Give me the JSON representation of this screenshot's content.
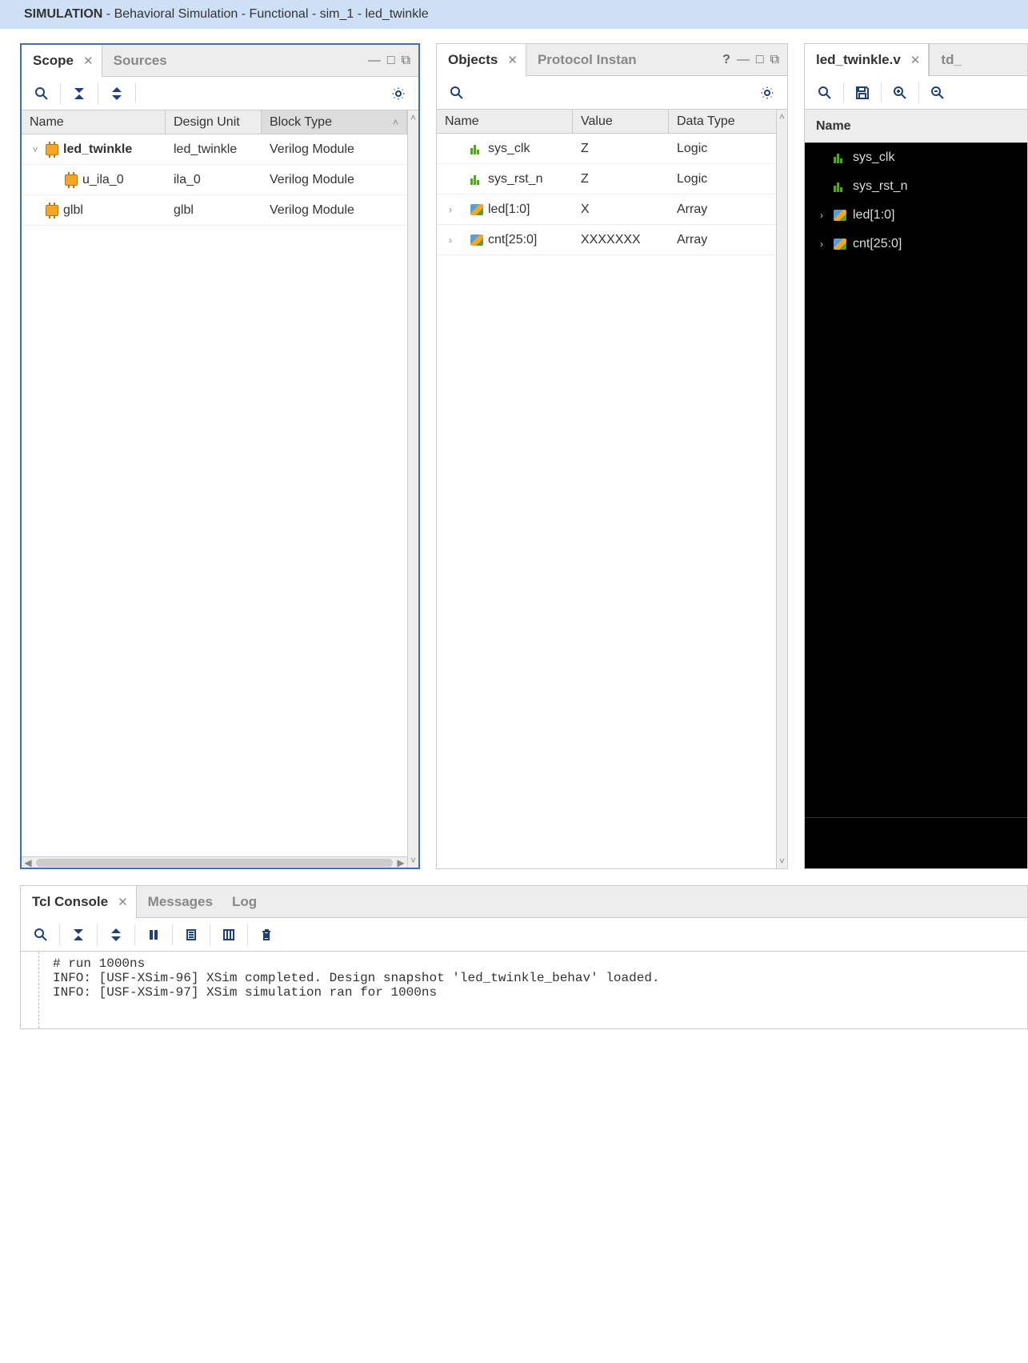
{
  "title": {
    "bold": "SIMULATION",
    "rest": " - Behavioral Simulation - Functional - sim_1 - led_twinkle"
  },
  "scope": {
    "tab_active": "Scope",
    "tab_inactive": "Sources",
    "cols": {
      "name": "Name",
      "design": "Design Unit",
      "block": "Block Type"
    },
    "rows": [
      {
        "indent": 0,
        "toggle": "v",
        "bold": true,
        "icon": "chip",
        "name": "led_twinkle",
        "design": "led_twinkle",
        "block": "Verilog Module"
      },
      {
        "indent": 1,
        "toggle": "",
        "bold": false,
        "icon": "chip",
        "name": "u_ila_0",
        "design": "ila_0",
        "block": "Verilog Module"
      },
      {
        "indent": 0,
        "toggle": "",
        "bold": false,
        "icon": "chip",
        "name": "glbl",
        "design": "glbl",
        "block": "Verilog Module"
      }
    ]
  },
  "objects": {
    "tab_active": "Objects",
    "tab_inactive": "Protocol Instan",
    "cols": {
      "name": "Name",
      "value": "Value",
      "type": "Data Type"
    },
    "rows": [
      {
        "toggle": "",
        "icon": "sig",
        "name": "sys_clk",
        "value": "Z",
        "type": "Logic"
      },
      {
        "toggle": "",
        "icon": "sig",
        "name": "sys_rst_n",
        "value": "Z",
        "type": "Logic"
      },
      {
        "toggle": ">",
        "icon": "bus",
        "name": "led[1:0]",
        "value": "X",
        "type": "Array"
      },
      {
        "toggle": ">",
        "icon": "bus",
        "name": "cnt[25:0]",
        "value": "XXXXXXX",
        "type": "Array"
      }
    ]
  },
  "wave": {
    "tab_active": "led_twinkle.v",
    "tab_inactive": "td_",
    "col_name": "Name",
    "rows": [
      {
        "toggle": "",
        "icon": "sig",
        "name": "sys_clk"
      },
      {
        "toggle": "",
        "icon": "sig",
        "name": "sys_rst_n"
      },
      {
        "toggle": ">",
        "icon": "bus",
        "name": "led[1:0]"
      },
      {
        "toggle": ">",
        "icon": "bus",
        "name": "cnt[25:0]"
      }
    ]
  },
  "console": {
    "tab_active": "Tcl Console",
    "tab2": "Messages",
    "tab3": "Log",
    "lines": [
      "# run 1000ns",
      "INFO: [USF-XSim-96] XSim completed. Design snapshot 'led_twinkle_behav' loaded.",
      "INFO: [USF-XSim-97] XSim simulation ran for 1000ns"
    ]
  }
}
